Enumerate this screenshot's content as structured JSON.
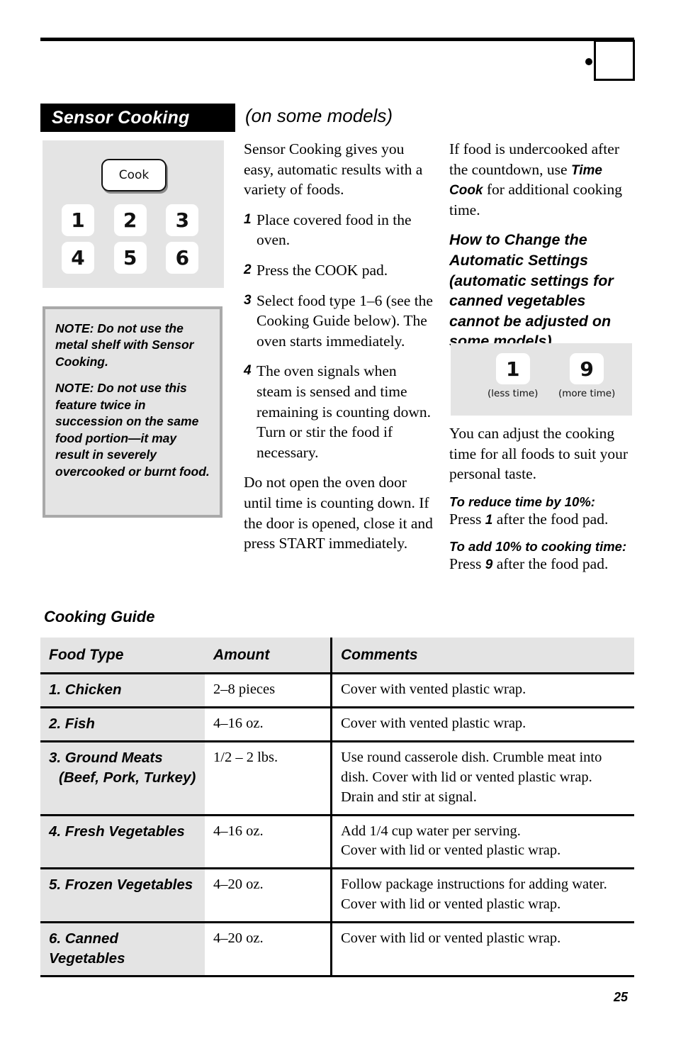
{
  "header": {
    "section_title": "Sensor Cooking",
    "models_note": "(on some models)",
    "corner_icon": "dial-knob-icon"
  },
  "keypad_panel": {
    "cook_label": "Cook",
    "keys": [
      "1",
      "2",
      "3",
      "4",
      "5",
      "6"
    ]
  },
  "notes": {
    "note1": "NOTE: Do not use the metal shelf with Sensor Cooking.",
    "note2": "NOTE: Do not use this feature twice in succession on the same food portion—it may result in severely overcooked or burnt food."
  },
  "middle_column": {
    "intro": "Sensor Cooking gives you easy, automatic results with a variety of foods.",
    "steps": [
      {
        "num": "1",
        "text": "Place covered food in the oven."
      },
      {
        "num": "2",
        "text": "Press the COOK pad."
      },
      {
        "num": "3",
        "text": "Select food type 1–6 (see the Cooking Guide below). The oven starts immediately."
      },
      {
        "num": "4",
        "text": "The oven signals when steam is sensed and time remaining is counting down. Turn or stir the food if necessary."
      }
    ],
    "closing": "Do not open the oven door until time is counting down. If the door is opened, close it and press START immediately."
  },
  "right_column": {
    "undercooked_pre": "If food is undercooked after the countdown, use ",
    "undercooked_bold": "Time Cook",
    "undercooked_post": " for additional cooking time.",
    "subhead": "How to Change the Automatic Settings (automatic settings for canned vegetables cannot be adjusted on some models)",
    "adjust_panel": {
      "less": {
        "key": "1",
        "caption": "(less time)"
      },
      "more": {
        "key": "9",
        "caption": "(more time)"
      }
    },
    "adjust_intro": "You can adjust the cooking time for all foods to suit your personal taste.",
    "tips": [
      {
        "lede": "To reduce time by 10%:",
        "pre": "Press ",
        "key": "1",
        "post": " after the food pad."
      },
      {
        "lede": "To add 10% to cooking time:",
        "pre": "Press ",
        "key": "9",
        "post": " after the food pad."
      }
    ]
  },
  "cooking_guide": {
    "title": "Cooking Guide",
    "columns": [
      "Food Type",
      "Amount",
      "Comments"
    ],
    "rows": [
      {
        "food": "1. Chicken",
        "food_sub": "",
        "amount": "2–8 pieces",
        "comments": [
          "Cover with vented plastic wrap."
        ]
      },
      {
        "food": "2. Fish",
        "food_sub": "",
        "amount": "4–16 oz.",
        "comments": [
          "Cover with vented plastic wrap."
        ]
      },
      {
        "food": "3. Ground Meats",
        "food_sub": "(Beef, Pork, Turkey)",
        "amount": "1/2 – 2 lbs.",
        "comments": [
          "Use round casserole dish. Crumble meat into",
          "dish. Cover with lid or vented plastic wrap.",
          "Drain and stir at signal."
        ]
      },
      {
        "food": "4. Fresh Vegetables",
        "food_sub": "",
        "amount": "4–16 oz.",
        "comments": [
          "Add 1/4 cup water per serving.",
          "Cover with lid or vented plastic wrap."
        ]
      },
      {
        "food": "5. Frozen Vegetables",
        "food_sub": "",
        "amount": "4–20 oz.",
        "comments": [
          "Follow package instructions for adding water.",
          "Cover with lid or vented plastic wrap."
        ]
      },
      {
        "food": "6. Canned Vegetables",
        "food_sub": "",
        "amount": "4–20 oz.",
        "comments": [
          "Cover with lid or vented plastic wrap."
        ]
      }
    ]
  },
  "footer": {
    "page_number": "25"
  },
  "colors": {
    "panel_gray": "#e4e4e4",
    "note_border": "#a9a9a9",
    "rule_black": "#000000"
  }
}
